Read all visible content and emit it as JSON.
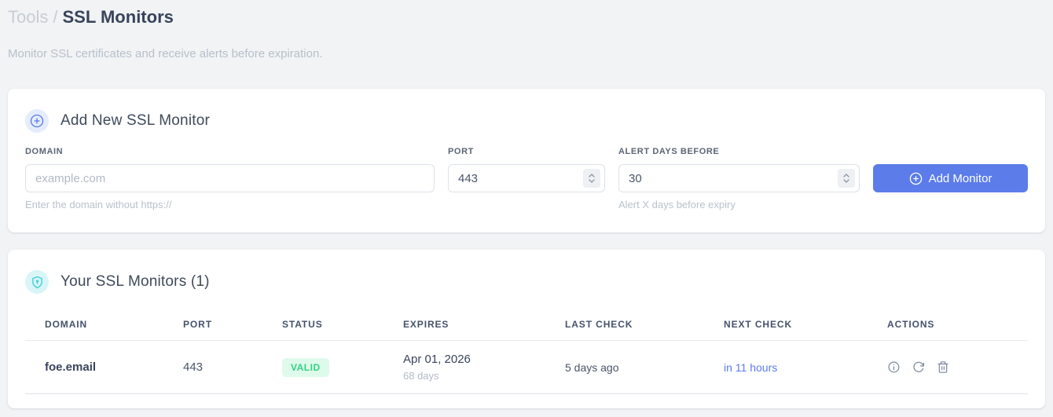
{
  "page": {
    "breadcrumb": {
      "parent": "Tools",
      "separator": "/",
      "current": "SSL Monitors"
    },
    "subtitle": "Monitor SSL certificates and receive alerts before expiration."
  },
  "add_monitor_card": {
    "title": "Add New SSL Monitor",
    "icon": "plus-circle-icon",
    "fields": {
      "domain": {
        "label": "DOMAIN",
        "placeholder": "example.com",
        "value": "",
        "helper": "Enter the domain without https://"
      },
      "port": {
        "label": "PORT",
        "value": "443"
      },
      "alert_days": {
        "label": "ALERT DAYS BEFORE",
        "value": "30",
        "helper": "Alert X days before expiry"
      }
    },
    "submit_label": "Add Monitor"
  },
  "monitors_card": {
    "title": "Your SSL Monitors (1)",
    "icon": "shield-icon",
    "table": {
      "headers": [
        "DOMAIN",
        "PORT",
        "STATUS",
        "EXPIRES",
        "LAST CHECK",
        "NEXT CHECK",
        "ACTIONS"
      ],
      "rows": [
        {
          "domain": "foe.email",
          "port": "443",
          "status": "VALID",
          "expires_date": "Apr 01, 2026",
          "expires_in": "68 days",
          "last_check": "5 days ago",
          "next_check": "in 11 hours",
          "actions": [
            "info-icon",
            "refresh-icon",
            "trash-icon"
          ]
        }
      ]
    }
  },
  "colors": {
    "accent_blue": "#5b7ce9",
    "accent_blue_bg": "#e5ecfb",
    "accent_cyan": "#35ccd6",
    "accent_cyan_bg": "#d8f5f7",
    "valid_text": "#33d286",
    "valid_bg": "#defaea",
    "page_bg": "#f1f3f4"
  }
}
